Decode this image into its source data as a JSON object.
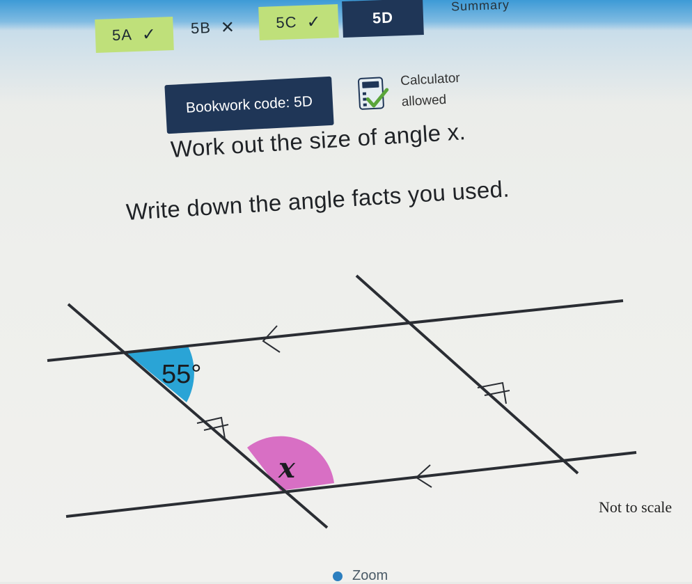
{
  "tabs": [
    {
      "label": "5A",
      "status": "✓",
      "status_icon": "check-icon"
    },
    {
      "label": "5B",
      "status": "✕",
      "status_icon": "cross-icon"
    },
    {
      "label": "5C",
      "status": "✓",
      "status_icon": "check-icon"
    },
    {
      "label": "5D",
      "status": "",
      "status_icon": ""
    },
    {
      "label": "Summary",
      "status": "",
      "status_icon": ""
    }
  ],
  "bookwork": {
    "label": "Bookwork code: 5D"
  },
  "calculator": {
    "line1": "Calculator",
    "line2": "allowed",
    "icon": "calculator-allowed-icon"
  },
  "question": {
    "line1": "Work out the size of angle x.",
    "line2": "Write down the angle facts you used."
  },
  "diagram": {
    "angle_given": "55°",
    "angle_unknown": "x",
    "note": "Not to scale",
    "colors": {
      "given_angle": "#2aa4d6",
      "unknown_angle": "#d86fc4",
      "lines": "#2a2d33"
    }
  },
  "zoom": {
    "label": "Zoom"
  },
  "colors": {
    "tab_done": "#bfe07a",
    "tab_active": "#1f3657",
    "top_blue": "#3d9ad6"
  }
}
